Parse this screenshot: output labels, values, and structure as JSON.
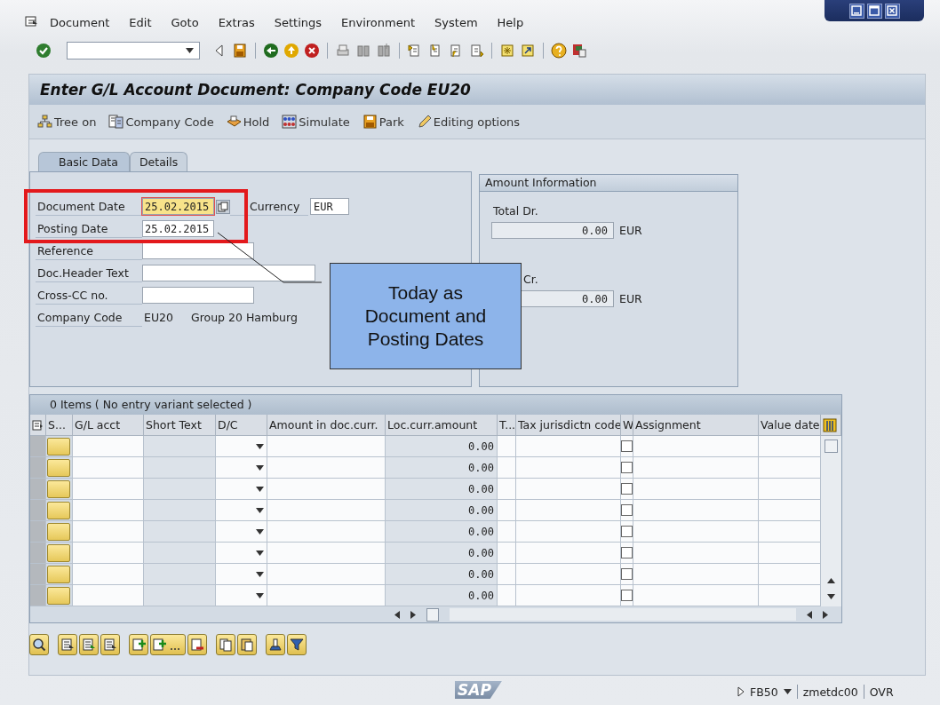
{
  "menu": [
    {
      "label": "Document"
    },
    {
      "label": "Edit"
    },
    {
      "label": "Goto"
    },
    {
      "label": "Extras"
    },
    {
      "label": "Settings"
    },
    {
      "label": "Environment"
    },
    {
      "label": "System"
    },
    {
      "label": "Help"
    }
  ],
  "title": "Enter G/L Account Document: Company Code EU20",
  "app_toolbar": [
    {
      "label": "Tree on"
    },
    {
      "label": "Company Code"
    },
    {
      "label": "Hold"
    },
    {
      "label": "Simulate"
    },
    {
      "label": "Park"
    },
    {
      "label": "Editing options"
    }
  ],
  "tabs": [
    {
      "label": "Basic Data",
      "selected": true
    },
    {
      "label": "Details",
      "selected": false
    }
  ],
  "header_fields": [
    {
      "kind": "date",
      "label": "Document Date",
      "value": "25.02.2015",
      "focused": true,
      "side_label": "Currency",
      "side_value": "EUR"
    },
    {
      "kind": "date",
      "label": "Posting Date",
      "value": "25.02.2015",
      "focused": false
    },
    {
      "kind": "field",
      "label": "Reference"
    },
    {
      "kind": "long",
      "label": "Doc.Header Text"
    },
    {
      "kind": "field",
      "label": "Cross-CC no."
    },
    {
      "kind": "display",
      "label": "Company Code",
      "value": "EU20",
      "description": "Group 20 Hamburg"
    }
  ],
  "amount_info": {
    "title": "Amount Information",
    "items": [
      {
        "label": "Total Dr.",
        "value": "0.00",
        "currency": "EUR"
      },
      {
        "label": "Cr.",
        "value": "0.00",
        "currency": "EUR"
      }
    ]
  },
  "callout": {
    "text": "Today as Document and Posting Dates"
  },
  "table": {
    "title": "0 Items ( No entry variant selected )",
    "columns": [
      "S...",
      "G/L acct",
      "Short Text",
      "D/C",
      "Amount in doc.curr.",
      "Loc.curr.amount",
      "T...",
      "Tax jurisdictn code",
      "W",
      "Assignment",
      "Value date"
    ],
    "rows": [
      {
        "loc_amount": "0.00",
        "checked": false
      },
      {
        "loc_amount": "0.00",
        "checked": false
      },
      {
        "loc_amount": "0.00",
        "checked": false
      },
      {
        "loc_amount": "0.00",
        "checked": false
      },
      {
        "loc_amount": "0.00",
        "checked": false
      },
      {
        "loc_amount": "0.00",
        "checked": false
      },
      {
        "loc_amount": "0.00",
        "checked": false
      },
      {
        "loc_amount": "0.00",
        "checked": false
      }
    ]
  },
  "status_bar": {
    "logo": "SAP",
    "transaction": "FB50",
    "server": "zmetdc00",
    "mode": "OVR"
  }
}
